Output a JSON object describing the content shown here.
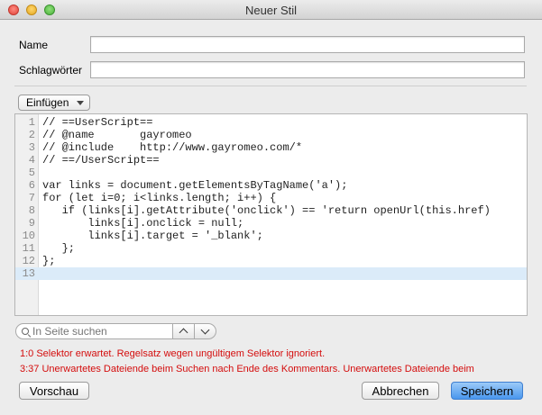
{
  "window": {
    "title": "Neuer Stil"
  },
  "form": {
    "name_label": "Name",
    "name_value": "",
    "keywords_label": "Schlagwörter",
    "keywords_value": ""
  },
  "toolbar": {
    "insert_label": "Einfügen"
  },
  "editor": {
    "lines": [
      {
        "n": "1",
        "text": "// ==UserScript=="
      },
      {
        "n": "2",
        "text": "// @name       gayromeo"
      },
      {
        "n": "3",
        "text": "// @include    http://www.gayromeo.com/*"
      },
      {
        "n": "4",
        "text": "// ==/UserScript=="
      },
      {
        "n": "5",
        "text": ""
      },
      {
        "n": "6",
        "text": "var links = document.getElementsByTagName('a');"
      },
      {
        "n": "7",
        "text": "for (let i=0; i<links.length; i++) {"
      },
      {
        "n": "8",
        "text": "   if (links[i].getAttribute('onclick') == 'return openUrl(this.href)"
      },
      {
        "n": "9",
        "text": "       links[i].onclick = null;"
      },
      {
        "n": "10",
        "text": "       links[i].target = '_blank';"
      },
      {
        "n": "11",
        "text": "   };"
      },
      {
        "n": "12",
        "text": "};"
      },
      {
        "n": "13",
        "text": ""
      }
    ],
    "active_line": "13"
  },
  "search": {
    "placeholder": "In Seite suchen",
    "value": ""
  },
  "errors": [
    "1:0 Selektor erwartet. Regelsatz wegen ungültigem Selektor ignoriert.",
    "3:37 Unerwartetes Dateiende beim Suchen nach Ende des Kommentars. Unerwartetes Dateiende beim"
  ],
  "buttons": {
    "preview": "Vorschau",
    "cancel": "Abbrechen",
    "save": "Speichern"
  },
  "colors": {
    "error": "#d40d0d",
    "primary_button": "#4a97ee",
    "active_line": "#dbebf9"
  }
}
